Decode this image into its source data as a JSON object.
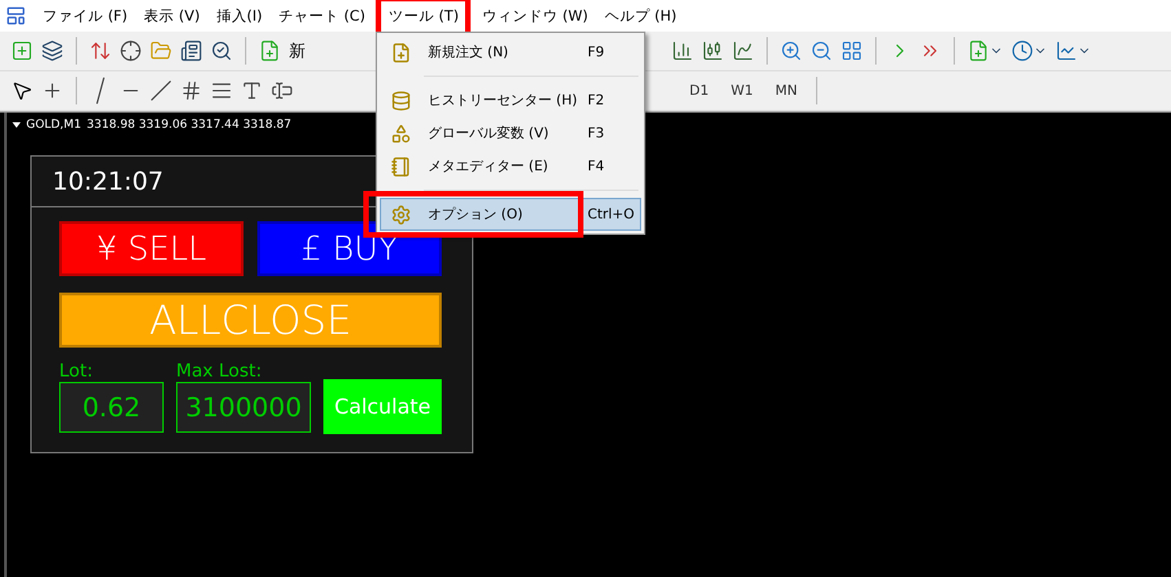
{
  "menu_bar": [
    {
      "label": "ファイル (F)",
      "selected": false
    },
    {
      "label": "表示 (V)",
      "selected": false
    },
    {
      "label": "挿入(I)",
      "selected": false
    },
    {
      "label": "チャート (C)",
      "selected": false
    },
    {
      "label": "ツール (T)",
      "selected": true
    },
    {
      "label": "ウィンドウ (W)",
      "selected": false
    },
    {
      "label": "ヘルプ (H)",
      "selected": false
    }
  ],
  "toolbar": {
    "new_order_label": "新",
    "timeframes": [
      "D1",
      "W1",
      "MN"
    ]
  },
  "dropdown": [
    {
      "kind": "item",
      "label": "新規注文 (N)",
      "shortcut": "F9",
      "selected": false
    },
    {
      "kind": "separator"
    },
    {
      "kind": "item",
      "label": "ヒストリーセンター (H)",
      "shortcut": "F2",
      "selected": false
    },
    {
      "kind": "item",
      "label": "グローバル変数 (V)",
      "shortcut": "F3",
      "selected": false
    },
    {
      "kind": "item",
      "label": "メタエディター (E)",
      "shortcut": "F4",
      "selected": false
    },
    {
      "kind": "separator"
    },
    {
      "kind": "item",
      "label": "オプション (O)",
      "shortcut": "Ctrl+O",
      "selected": true
    }
  ],
  "chart": {
    "symbol": "GOLD,M1",
    "quote": "3318.98 3319.06 3317.44 3318.87"
  },
  "panel": {
    "time": "10:21:07",
    "sell": "¥ SELL",
    "buy": "£ BUY",
    "allclose": "ALLCLOSE",
    "lot_label": "Lot:",
    "lot_value": "0.62",
    "max_lost_label": "Max Lost:",
    "max_lost_value": "3100000",
    "calculate": "Calculate"
  }
}
